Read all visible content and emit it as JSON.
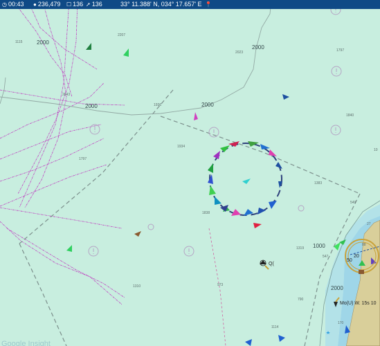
{
  "status_bar": {
    "time": "00:43",
    "time_icon": "clock-icon",
    "visitors": "236,479",
    "visitors_icon": "globe-icon",
    "tracked": "136",
    "tracked_icon": "square-icon",
    "underway": "136",
    "underway_icon": "navigation-arrow-icon",
    "coordinates": "33° 11.388' N, 034° 17.657' E",
    "pin_icon": "pin-icon",
    "colors": {
      "bar": "#0f4a86",
      "sea": "#c8eedf",
      "land": "#d9cf9a"
    }
  },
  "map": {
    "depth_contour_labels": [
      "2000",
      "2000",
      "2000",
      "2000",
      "1000",
      "2000"
    ],
    "soundings": [
      "2207",
      "1115",
      "2023",
      "1797",
      "2643",
      "1936",
      "1840",
      "1934",
      "1797",
      "1383",
      "549",
      "1838",
      "1319",
      "547",
      "1310",
      "973",
      "1114",
      "790",
      "170",
      "27",
      "88",
      "10"
    ],
    "beacon_label": "Q(",
    "light_label": "Mo(U) W. 15s 10",
    "light_number": "20",
    "depth_50": "50",
    "watermark": "Google Insight"
  }
}
